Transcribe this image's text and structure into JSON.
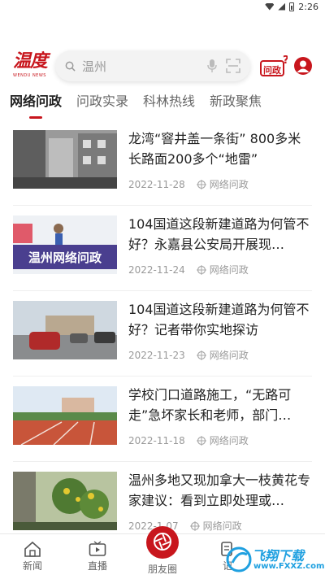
{
  "status": {
    "time": "2:26"
  },
  "header": {
    "logo_text": "温度",
    "logo_subtext": "WENDU NEWS",
    "search_placeholder": "温州",
    "wenzheng_label": "问政"
  },
  "tabs": [
    {
      "label": "网络问政",
      "active": true
    },
    {
      "label": "问政实录",
      "active": false
    },
    {
      "label": "科林热线",
      "active": false
    },
    {
      "label": "新政聚焦",
      "active": false
    }
  ],
  "articles": [
    {
      "title": "龙湾“窨井盖一条街” 800多米长路面200多个“地雷”",
      "date": "2022-11-28",
      "source": "网络问政"
    },
    {
      "title": "104国道这段新建道路为何管不好？永嘉县公安局开展现…",
      "date": "2022-11-24",
      "source": "网络问政",
      "banner": "温州网络问政"
    },
    {
      "title": "104国道这段新建道路为何管不好？记者带你实地探访",
      "date": "2022-11-23",
      "source": "网络问政"
    },
    {
      "title": "学校门口道路施工，“无路可走”急坏家长和老师，部门…",
      "date": "2022-11-18",
      "source": "网络问政"
    },
    {
      "title": "温州多地又现加拿大一枝黄花专家建议：看到立即处理或…",
      "date": "2022-1 07",
      "source": "网络问政"
    }
  ],
  "bottom_nav": [
    {
      "label": "新闻"
    },
    {
      "label": "直播"
    },
    {
      "label": "朋友圈"
    },
    {
      "label": "记"
    }
  ],
  "watermark": {
    "brand": "飞翔下载",
    "url": "www.FXXZ.com"
  },
  "colors": {
    "accent": "#c8161d",
    "watermark": "#1fa0e0"
  }
}
